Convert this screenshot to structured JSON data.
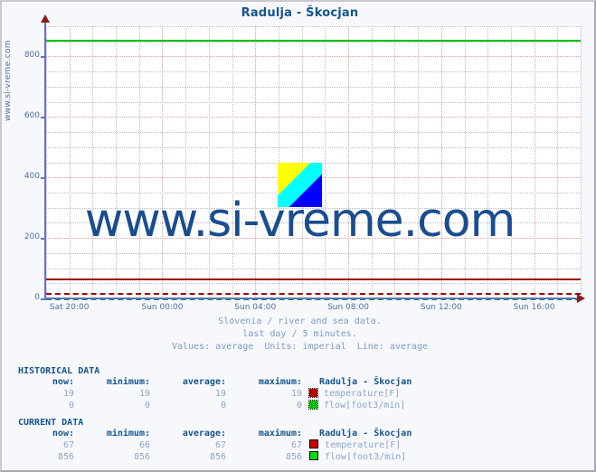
{
  "page": {
    "site_label": "www.si-vreme.com",
    "watermark_text": "www.si-vreme.com",
    "watermark_logo_name": "si-vreme-logo"
  },
  "chart_data": {
    "type": "line",
    "title": "Radulja - Škocjan",
    "xlabel": "",
    "ylabel": "",
    "ylim": [
      0,
      900
    ],
    "yticks": [
      0,
      200,
      400,
      600,
      800
    ],
    "ytick_labels": [
      "0",
      "200",
      "400",
      "600",
      "800"
    ],
    "xticks": [
      "Sat 20:00",
      "Sun 00:00",
      "Sun 04:00",
      "Sun 08:00",
      "Sun 12:00",
      "Sun 16:00"
    ],
    "grid": true,
    "legend_position": "below",
    "subtitle_lines": [
      "Slovenia / river and sea data.",
      "last day / 5 minutes.",
      "Values: average  Units: imperial  Line: average"
    ],
    "series": [
      {
        "name": "flow[foot3/min]",
        "dataset": "current",
        "value": 856,
        "color": "#00c000",
        "style": "solid"
      },
      {
        "name": "temperature[F]",
        "dataset": "current",
        "value": 67,
        "color": "#a00000",
        "style": "solid"
      },
      {
        "name": "temperature[F]",
        "dataset": "historical",
        "value": 19,
        "color": "#a00000",
        "style": "dashed"
      },
      {
        "name": "flow[foot3/min]",
        "dataset": "historical",
        "value": 0,
        "color": "#00a000",
        "style": "dashed"
      }
    ]
  },
  "historical": {
    "heading": "HISTORICAL DATA",
    "columns": [
      "now:",
      "minimum:",
      "average:",
      "maximum:"
    ],
    "series_header": "Radulja - Škocjan",
    "rows": [
      {
        "now": "19",
        "minimum": "19",
        "average": "19",
        "maximum": "19",
        "label": "temperature[F]",
        "swatch": "temp-hist"
      },
      {
        "now": "0",
        "minimum": "0",
        "average": "0",
        "maximum": "0",
        "label": "flow[foot3/min]",
        "swatch": "flow-hist"
      }
    ]
  },
  "current": {
    "heading": "CURRENT DATA",
    "columns": [
      "now:",
      "minimum:",
      "average:",
      "maximum:"
    ],
    "series_header": "Radulja - Škocjan",
    "rows": [
      {
        "now": "67",
        "minimum": "66",
        "average": "67",
        "maximum": "67",
        "label": "temperature[F]",
        "swatch": "temp-cur"
      },
      {
        "now": "856",
        "minimum": "856",
        "average": "856",
        "maximum": "856",
        "label": "flow[foot3/min]",
        "swatch": "flow-cur"
      }
    ]
  }
}
